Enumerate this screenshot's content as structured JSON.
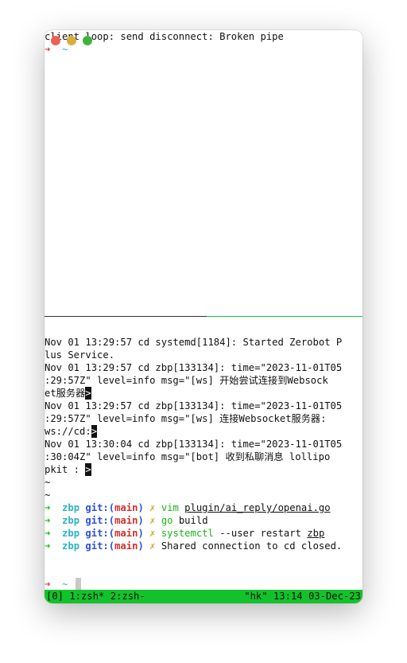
{
  "top_pane": {
    "line1": "client loop: send disconnect: Broken pipe",
    "prompt_arrow": "➜",
    "prompt_dir": "~"
  },
  "log": {
    "lines": [
      "Nov 01 13:29:57 cd systemd[1184]: Started Zerobot P",
      "lus Service.",
      "Nov 01 13:29:57 cd zbp[133134]: time=\"2023-11-01T05",
      ":29:57Z\" level=info msg=\"[ws] 开始尝试连接到Websock",
      "et服务器",
      "Nov 01 13:29:57 cd zbp[133134]: time=\"2023-11-01T05",
      ":29:57Z\" level=info msg=\"[ws] 连接Websocket服务器:",
      "ws://cd:",
      "Nov 01 13:30:04 cd zbp[133134]: time=\"2023-11-01T05",
      ":30:04Z\" level=info msg=\"[bot] 收到私聊消息 lollipo",
      "pkit : "
    ],
    "cursor_char": ">",
    "tilde": "~"
  },
  "history": [
    {
      "arrow": "➜",
      "dir": "zbp",
      "git": "git:(",
      "branch": "main",
      "git_close": ")",
      "dirty": "✗",
      "cmd": "vim",
      "args": "plugin/ai_reply/openai.go",
      "args_underlined": true
    },
    {
      "arrow": "➜",
      "dir": "zbp",
      "git": "git:(",
      "branch": "main",
      "git_close": ")",
      "dirty": "✗",
      "cmd": "go",
      "args": "build",
      "args_underlined": false
    },
    {
      "arrow": "➜",
      "dir": "zbp",
      "git": "git:(",
      "branch": "main",
      "git_close": ")",
      "dirty": "✗",
      "cmd": "systemctl",
      "args": "--user restart ",
      "args2": "zbp",
      "args_underlined": false
    },
    {
      "arrow": "➜",
      "dir": "zbp",
      "git": "git:(",
      "branch": "main",
      "git_close": ")",
      "dirty": "✗",
      "cmd": "Shared connection to cd closed.",
      "args": "",
      "args_underlined": false
    }
  ],
  "bottom_prompt": {
    "arrow": "➜",
    "dir": "~"
  },
  "status_bar": {
    "left": "[0] 1:zsh* 2:zsh-",
    "right": "\"hk\" 13:14 03-Dec-23"
  },
  "colors": {
    "status_bar": "#12c22a",
    "prompt_arrow_top": "#e04040",
    "prompt_arrow": "#12c012",
    "dir": "#2bb3c4",
    "git": "#2a50d8",
    "branch": "#d0302f",
    "dirty": "#d3a62b"
  }
}
